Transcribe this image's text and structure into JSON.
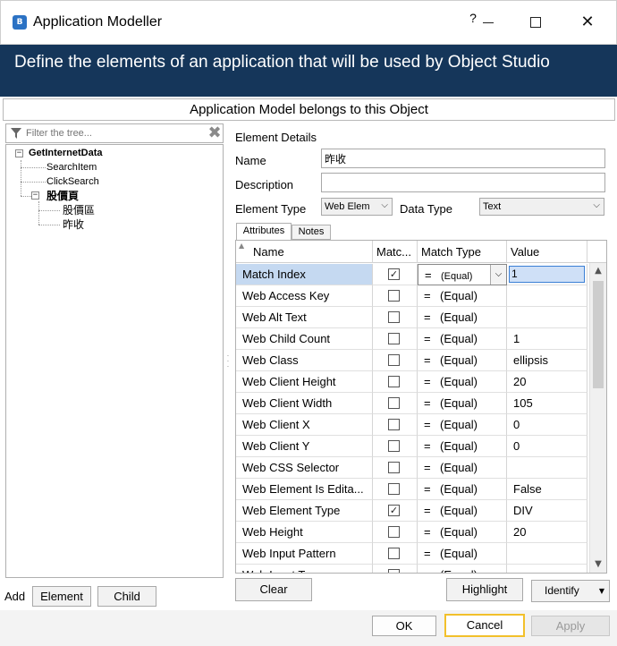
{
  "window": {
    "title": "Application Modeller",
    "help_glyph": "?",
    "app_icon": "blueprism-app-icon",
    "close_glyph": "✕"
  },
  "banner": {
    "text": "Define the elements of an application that will be used by Object Studio"
  },
  "subheader": {
    "text": "Application Model belongs to this Object"
  },
  "tree": {
    "filter_placeholder": "Filter the tree...",
    "clear_glyph": "✖",
    "items": [
      {
        "label": "GetInternetData",
        "bold": true
      },
      {
        "label": "SearchItem",
        "bold": false
      },
      {
        "label": "ClickSearch",
        "bold": false
      },
      {
        "label": "股價頁",
        "bold": true
      },
      {
        "label": "股價區",
        "bold": false
      },
      {
        "label": "昨收",
        "bold": false
      }
    ]
  },
  "add_bar": {
    "label": "Add",
    "element_button": "Element",
    "child_button": "Child"
  },
  "details": {
    "title": "Element Details",
    "name_label": "Name",
    "name_value": "昨收",
    "description_label": "Description",
    "description_value": "",
    "element_type_label": "Element Type",
    "element_type_value": "Web Elem",
    "data_type_label": "Data Type",
    "data_type_value": "Text"
  },
  "tabs": {
    "attributes": "Attributes",
    "notes": "Notes"
  },
  "grid": {
    "columns": {
      "name": "Name",
      "match": "Matc...",
      "match_type": "Match Type",
      "value": "Value"
    },
    "eq_symbol": "=",
    "rows": [
      {
        "name": "Match Index",
        "checked": true,
        "match_type": "(Equal)",
        "value": "1"
      },
      {
        "name": "Web Access Key",
        "checked": false,
        "match_type": "(Equal)",
        "value": ""
      },
      {
        "name": "Web Alt Text",
        "checked": false,
        "match_type": "(Equal)",
        "value": ""
      },
      {
        "name": "Web Child Count",
        "checked": false,
        "match_type": "(Equal)",
        "value": "1"
      },
      {
        "name": "Web Class",
        "checked": false,
        "match_type": "(Equal)",
        "value": "ellipsis"
      },
      {
        "name": "Web Client Height",
        "checked": false,
        "match_type": "(Equal)",
        "value": "20"
      },
      {
        "name": "Web Client Width",
        "checked": false,
        "match_type": "(Equal)",
        "value": "105"
      },
      {
        "name": "Web Client X",
        "checked": false,
        "match_type": "(Equal)",
        "value": "0"
      },
      {
        "name": "Web Client Y",
        "checked": false,
        "match_type": "(Equal)",
        "value": "0"
      },
      {
        "name": "Web CSS Selector",
        "checked": false,
        "match_type": "(Equal)",
        "value": ""
      },
      {
        "name": "Web Element Is Edita...",
        "checked": false,
        "match_type": "(Equal)",
        "value": "False"
      },
      {
        "name": "Web Element Type",
        "checked": true,
        "match_type": "(Equal)",
        "value": "DIV"
      },
      {
        "name": "Web Height",
        "checked": false,
        "match_type": "(Equal)",
        "value": "20"
      },
      {
        "name": "Web Input Pattern",
        "checked": false,
        "match_type": "(Equal)",
        "value": ""
      },
      {
        "name": "Web Input Type",
        "checked": false,
        "match_type": "(Equal)",
        "value": ""
      }
    ]
  },
  "actions": {
    "clear": "Clear",
    "highlight": "Highlight",
    "identify": "Identify"
  },
  "dialog_buttons": {
    "ok": "OK",
    "cancel": "Cancel",
    "apply": "Apply"
  },
  "colors": {
    "banner_bg": "#15365a",
    "selection_bg": "#c5d9f1",
    "focus_border": "#f2c02b"
  }
}
